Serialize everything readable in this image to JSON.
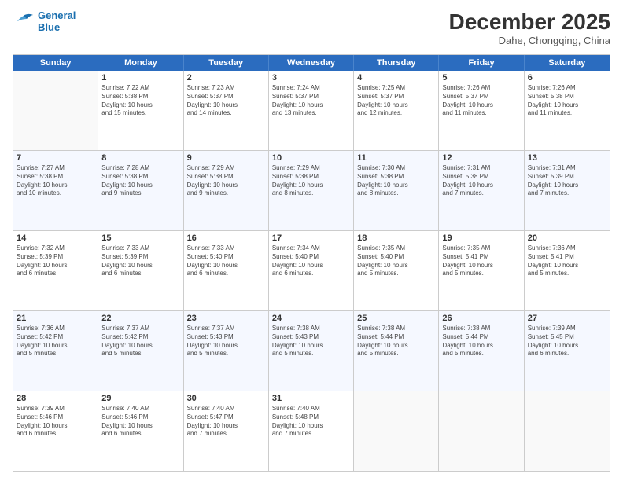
{
  "logo": {
    "line1": "General",
    "line2": "Blue"
  },
  "header": {
    "month": "December 2025",
    "location": "Dahe, Chongqing, China"
  },
  "weekdays": [
    "Sunday",
    "Monday",
    "Tuesday",
    "Wednesday",
    "Thursday",
    "Friday",
    "Saturday"
  ],
  "weeks": [
    [
      {
        "day": "",
        "info": ""
      },
      {
        "day": "1",
        "info": "Sunrise: 7:22 AM\nSunset: 5:38 PM\nDaylight: 10 hours\nand 15 minutes."
      },
      {
        "day": "2",
        "info": "Sunrise: 7:23 AM\nSunset: 5:37 PM\nDaylight: 10 hours\nand 14 minutes."
      },
      {
        "day": "3",
        "info": "Sunrise: 7:24 AM\nSunset: 5:37 PM\nDaylight: 10 hours\nand 13 minutes."
      },
      {
        "day": "4",
        "info": "Sunrise: 7:25 AM\nSunset: 5:37 PM\nDaylight: 10 hours\nand 12 minutes."
      },
      {
        "day": "5",
        "info": "Sunrise: 7:26 AM\nSunset: 5:37 PM\nDaylight: 10 hours\nand 11 minutes."
      },
      {
        "day": "6",
        "info": "Sunrise: 7:26 AM\nSunset: 5:38 PM\nDaylight: 10 hours\nand 11 minutes."
      }
    ],
    [
      {
        "day": "7",
        "info": "Sunrise: 7:27 AM\nSunset: 5:38 PM\nDaylight: 10 hours\nand 10 minutes."
      },
      {
        "day": "8",
        "info": "Sunrise: 7:28 AM\nSunset: 5:38 PM\nDaylight: 10 hours\nand 9 minutes."
      },
      {
        "day": "9",
        "info": "Sunrise: 7:29 AM\nSunset: 5:38 PM\nDaylight: 10 hours\nand 9 minutes."
      },
      {
        "day": "10",
        "info": "Sunrise: 7:29 AM\nSunset: 5:38 PM\nDaylight: 10 hours\nand 8 minutes."
      },
      {
        "day": "11",
        "info": "Sunrise: 7:30 AM\nSunset: 5:38 PM\nDaylight: 10 hours\nand 8 minutes."
      },
      {
        "day": "12",
        "info": "Sunrise: 7:31 AM\nSunset: 5:38 PM\nDaylight: 10 hours\nand 7 minutes."
      },
      {
        "day": "13",
        "info": "Sunrise: 7:31 AM\nSunset: 5:39 PM\nDaylight: 10 hours\nand 7 minutes."
      }
    ],
    [
      {
        "day": "14",
        "info": "Sunrise: 7:32 AM\nSunset: 5:39 PM\nDaylight: 10 hours\nand 6 minutes."
      },
      {
        "day": "15",
        "info": "Sunrise: 7:33 AM\nSunset: 5:39 PM\nDaylight: 10 hours\nand 6 minutes."
      },
      {
        "day": "16",
        "info": "Sunrise: 7:33 AM\nSunset: 5:40 PM\nDaylight: 10 hours\nand 6 minutes."
      },
      {
        "day": "17",
        "info": "Sunrise: 7:34 AM\nSunset: 5:40 PM\nDaylight: 10 hours\nand 6 minutes."
      },
      {
        "day": "18",
        "info": "Sunrise: 7:35 AM\nSunset: 5:40 PM\nDaylight: 10 hours\nand 5 minutes."
      },
      {
        "day": "19",
        "info": "Sunrise: 7:35 AM\nSunset: 5:41 PM\nDaylight: 10 hours\nand 5 minutes."
      },
      {
        "day": "20",
        "info": "Sunrise: 7:36 AM\nSunset: 5:41 PM\nDaylight: 10 hours\nand 5 minutes."
      }
    ],
    [
      {
        "day": "21",
        "info": "Sunrise: 7:36 AM\nSunset: 5:42 PM\nDaylight: 10 hours\nand 5 minutes."
      },
      {
        "day": "22",
        "info": "Sunrise: 7:37 AM\nSunset: 5:42 PM\nDaylight: 10 hours\nand 5 minutes."
      },
      {
        "day": "23",
        "info": "Sunrise: 7:37 AM\nSunset: 5:43 PM\nDaylight: 10 hours\nand 5 minutes."
      },
      {
        "day": "24",
        "info": "Sunrise: 7:38 AM\nSunset: 5:43 PM\nDaylight: 10 hours\nand 5 minutes."
      },
      {
        "day": "25",
        "info": "Sunrise: 7:38 AM\nSunset: 5:44 PM\nDaylight: 10 hours\nand 5 minutes."
      },
      {
        "day": "26",
        "info": "Sunrise: 7:38 AM\nSunset: 5:44 PM\nDaylight: 10 hours\nand 5 minutes."
      },
      {
        "day": "27",
        "info": "Sunrise: 7:39 AM\nSunset: 5:45 PM\nDaylight: 10 hours\nand 6 minutes."
      }
    ],
    [
      {
        "day": "28",
        "info": "Sunrise: 7:39 AM\nSunset: 5:46 PM\nDaylight: 10 hours\nand 6 minutes."
      },
      {
        "day": "29",
        "info": "Sunrise: 7:40 AM\nSunset: 5:46 PM\nDaylight: 10 hours\nand 6 minutes."
      },
      {
        "day": "30",
        "info": "Sunrise: 7:40 AM\nSunset: 5:47 PM\nDaylight: 10 hours\nand 7 minutes."
      },
      {
        "day": "31",
        "info": "Sunrise: 7:40 AM\nSunset: 5:48 PM\nDaylight: 10 hours\nand 7 minutes."
      },
      {
        "day": "",
        "info": ""
      },
      {
        "day": "",
        "info": ""
      },
      {
        "day": "",
        "info": ""
      }
    ]
  ]
}
